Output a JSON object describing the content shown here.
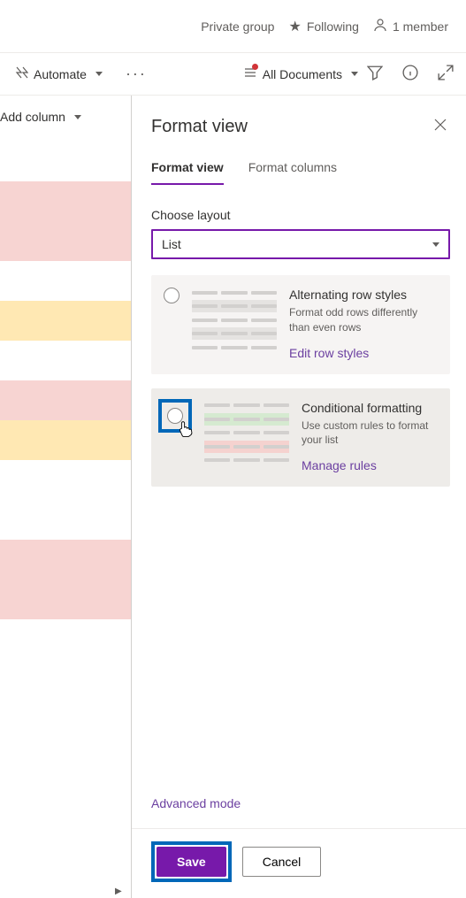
{
  "header": {
    "group_label": "Private group",
    "following_label": "Following",
    "members_label": "1 member"
  },
  "command_bar": {
    "automate_label": "Automate",
    "view_selector": "All Documents"
  },
  "list": {
    "add_column_label": "Add column"
  },
  "panel": {
    "title": "Format view",
    "tabs": {
      "format_view": "Format view",
      "format_columns": "Format columns"
    },
    "choose_layout_label": "Choose layout",
    "layout_value": "List",
    "options": {
      "alternating": {
        "title": "Alternating row styles",
        "desc": "Format odd rows differently than even rows",
        "link": "Edit row styles"
      },
      "conditional": {
        "title": "Conditional formatting",
        "desc": "Use custom rules to format your list",
        "link": "Manage rules"
      }
    },
    "advanced_label": "Advanced mode",
    "buttons": {
      "save": "Save",
      "cancel": "Cancel"
    }
  }
}
